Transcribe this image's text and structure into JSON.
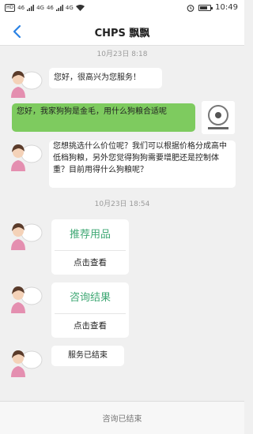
{
  "status_bar": {
    "left_glyphs": [
      "HD",
      "46",
      "4G",
      "46",
      "4G"
    ],
    "time": "10:49",
    "battery_level": 0.7
  },
  "header": {
    "title": "CHPS 飘飘"
  },
  "chat": {
    "timestamps": [
      "10月23日 8:18",
      "10月23日 18:54"
    ],
    "messages": [
      "您好，很高兴为您服务！",
      "您好，我家狗狗是金毛，用什么狗粮合适呢",
      "您想挑选什么价位呢？我们可以根据价格分成高中低档狗粮，另外您觉得狗狗需要增肥还是控制体重？目前用得什么狗粮呢？",
      "服务已结束"
    ],
    "cards": [
      {
        "title": "推荐用品",
        "action": "点击查看"
      },
      {
        "title": "咨询结果",
        "action": "点击查看"
      }
    ]
  },
  "footer": {
    "label": "咨询已结束"
  },
  "colors": {
    "accent_blue": "#2a82e4",
    "my_bubble": "#7ecb5f",
    "card_title": "#3fa874",
    "background": "#f0f0f0"
  },
  "icons": [
    "back-arrow-icon",
    "wifi-icon",
    "alarm-icon",
    "battery-icon",
    "agent-avatar-icon",
    "user-avatar-icon"
  ]
}
